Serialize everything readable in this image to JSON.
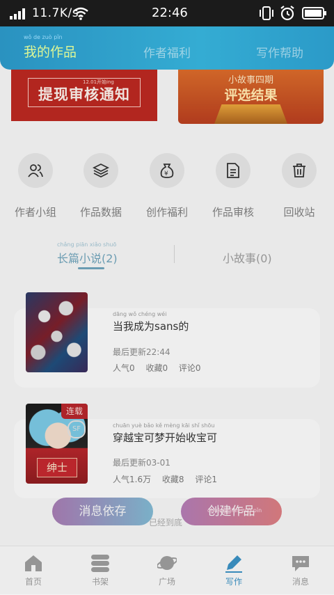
{
  "status_bar": {
    "network_speed": "11.7K/s",
    "time": "22:46"
  },
  "header": {
    "tabs": [
      {
        "label": "我的作品",
        "pinyin": "wǒ  de  zuò  pǐn",
        "active": true
      },
      {
        "label": "作者福利",
        "active": false
      },
      {
        "label": "写作帮助",
        "active": false
      }
    ]
  },
  "banners": {
    "left": {
      "small_text": "12.01开始ing",
      "title": "提现审核通知"
    },
    "right": {
      "line1": "小故事四期",
      "line2": "评选结果"
    }
  },
  "shortcuts": [
    {
      "icon": "people-icon",
      "label": "作者小组"
    },
    {
      "icon": "layers-icon",
      "label": "作品数据"
    },
    {
      "icon": "money-bag-icon",
      "label": "创作福利"
    },
    {
      "icon": "document-icon",
      "label": "作品审核"
    },
    {
      "icon": "trash-icon",
      "label": "回收站"
    }
  ],
  "work_tabs": [
    {
      "label": "长篇小说(2)",
      "pinyin": "chǎng piān xiǎo shuō",
      "active": true
    },
    {
      "label": "小故事(0)",
      "active": false
    }
  ],
  "works": [
    {
      "title": "当我成为sans的",
      "title_pinyin": "dāng  wǒ  chéng wéi",
      "updated": "最后更新22:44",
      "stats": "人气0 收藏0 评论0"
    },
    {
      "badge": "连载",
      "title": "穿越宝可梦开始收宝可",
      "title_pinyin": "chuān yuè bǎo  kě  mèng kāi  shǐ  shōu",
      "cover_text": "绅士",
      "updated": "最后更新03-01",
      "stats": "人气1.6万 收藏8 评论1"
    }
  ],
  "actions": {
    "primary": "消息依存",
    "secondary": "创建作品",
    "secondary_pinyin": "chuàng jiàn  zuò  pǐn",
    "under_text": "已经到底"
  },
  "bottom_nav": [
    {
      "icon": "home-icon",
      "label": "首页",
      "active": false
    },
    {
      "icon": "bookshelf-icon",
      "label": "书架",
      "active": false
    },
    {
      "icon": "planet-icon",
      "label": "广场",
      "active": false
    },
    {
      "icon": "pen-icon",
      "label": "写作",
      "active": true
    },
    {
      "icon": "chat-icon",
      "label": "消息",
      "active": false
    }
  ],
  "colors": {
    "accent": "#36b2da",
    "active_tab": "#6fa2b8",
    "nav_active": "#3a8fc0"
  }
}
